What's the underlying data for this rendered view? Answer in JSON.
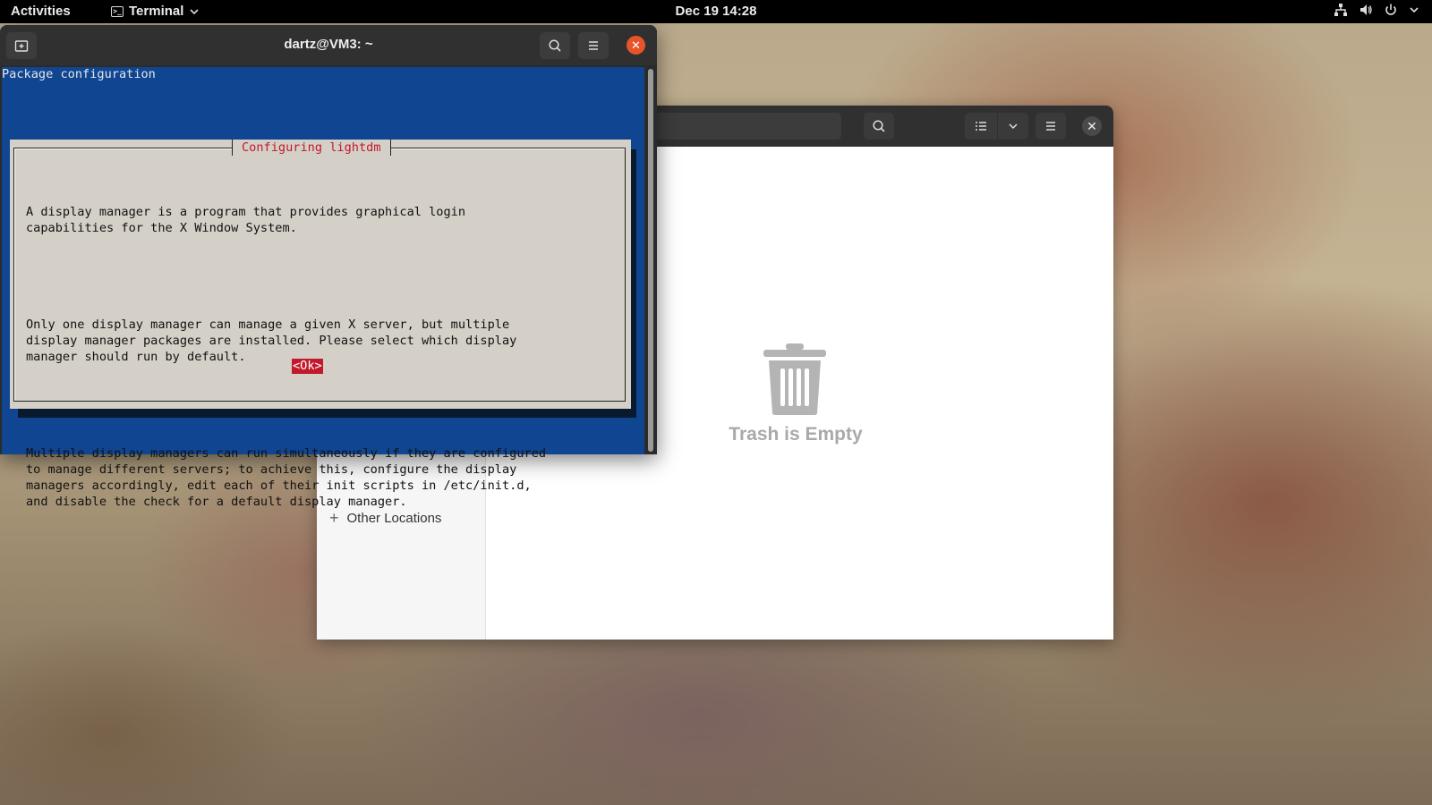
{
  "topbar": {
    "activities": "Activities",
    "app_name": "Terminal",
    "clock": "Dec 19  14:28",
    "tray_icons": [
      "network-icon",
      "volume-icon",
      "power-icon",
      "chevron-down-icon"
    ]
  },
  "terminal": {
    "title": "dartz@VM3: ~",
    "package_header": "Package configuration",
    "dialog": {
      "title": "Configuring lightdm",
      "paragraphs": [
        "A display manager is a program that provides graphical login\ncapabilities for the X Window System.",
        "Only one display manager can manage a given X server, but multiple\ndisplay manager packages are installed. Please select which display\nmanager should run by default.",
        "Multiple display managers can run simultaneously if they are configured\nto manage different servers; to achieve this, configure the display\nmanagers accordingly, edit each of their init scripts in /etc/init.d,\nand disable the check for a default display manager."
      ],
      "ok_label": "<Ok>"
    }
  },
  "files": {
    "sidebar": {
      "other_locations": "Other Locations"
    },
    "empty_state": "Trash is Empty"
  },
  "colors": {
    "terminal_bg": "#0f4591",
    "dialog_bg": "#d4d0c8",
    "accent_red": "#c21a2c",
    "close_orange": "#e8542a"
  }
}
